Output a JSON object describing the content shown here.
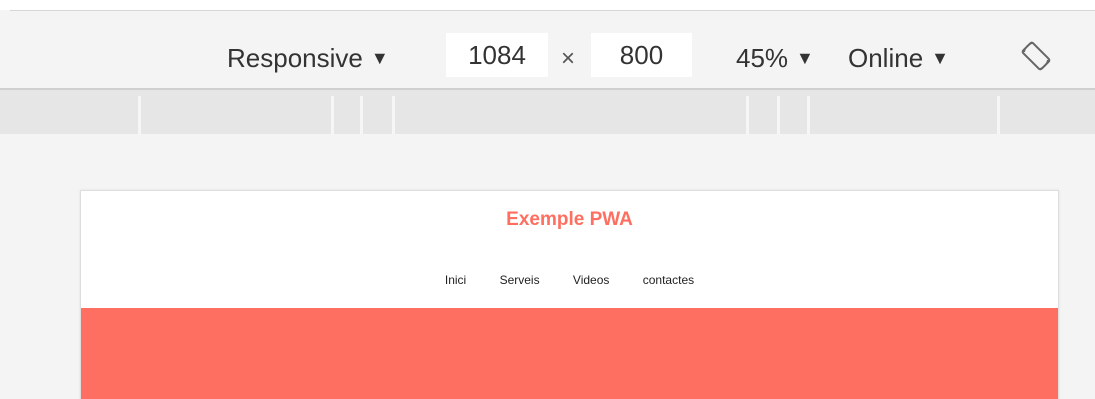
{
  "toolbar": {
    "device_label": "Responsive",
    "dropdown_arrow": "▼",
    "width_value": "1084",
    "times_sign": "×",
    "height_value": "800",
    "zoom_label": "45%",
    "network_label": "Online",
    "rotate_icon": "rotate-icon"
  },
  "site": {
    "title": "Exemple PWA",
    "nav": [
      "Inici",
      "Serveis",
      "Videos",
      "contactes"
    ]
  },
  "colors": {
    "accent": "#ff6f61",
    "toolbar_bg": "#f4f4f4",
    "media_bar_bg": "#e6e6e6"
  }
}
